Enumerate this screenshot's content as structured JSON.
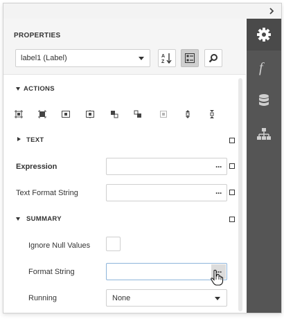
{
  "panel": {
    "title": "PROPERTIES",
    "component_select": {
      "value": "label1 (Label)"
    }
  },
  "toolbar": {
    "sort_icon": "sort-alphabetical-icon",
    "categorized_icon": "categorized-icon",
    "search_icon": "search-icon"
  },
  "sections": {
    "actions": {
      "label": "ACTIONS",
      "expanded": true
    },
    "text": {
      "label": "TEXT",
      "expanded": false
    },
    "summary": {
      "label": "SUMMARY",
      "expanded": true
    }
  },
  "action_icons": [
    "align-to-grid-icon",
    "size-to-grid-icon",
    "center-horizontally-icon",
    "center-vertically-icon",
    "bring-to-front-icon",
    "send-to-back-icon",
    "fit-bounds-to-container-icon",
    "increase-vertical-spacing-icon",
    "decrease-vertical-spacing-icon"
  ],
  "properties": {
    "expression": {
      "label": "Expression",
      "value": ""
    },
    "text_format_string": {
      "label": "Text Format String",
      "value": ""
    },
    "ignore_null_values": {
      "label": "Ignore Null Values",
      "checked": false
    },
    "format_string": {
      "label": "Format String",
      "value": ""
    },
    "running": {
      "label": "Running",
      "value": "None"
    }
  },
  "right_tabs": [
    {
      "icon": "gear-icon",
      "active": true
    },
    {
      "icon": "function-icon",
      "active": false
    },
    {
      "icon": "database-icon",
      "active": false
    },
    {
      "icon": "report-explorer-icon",
      "active": false
    }
  ],
  "colors": {
    "side_panel": "#555555",
    "header_bg": "#f5f5f5",
    "focus_border": "#8db4da"
  }
}
